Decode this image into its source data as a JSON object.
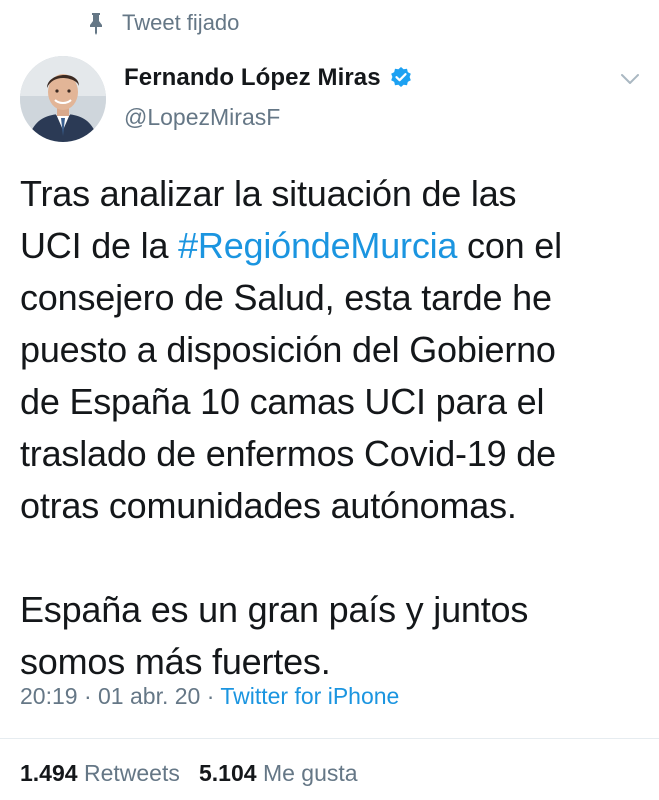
{
  "pinned_label": "Tweet fijado",
  "author": {
    "name": "Fernando López Miras",
    "handle": "@LopezMirasF",
    "verified": true
  },
  "tweet": {
    "line1": "Tras analizar la situación de las",
    "line2_pre": "UCI de la ",
    "hashtag": "#RegióndeMurcia",
    "line2_post": " con el",
    "line3": "consejero de Salud, esta tarde he",
    "line4": "puesto a disposición del Gobierno",
    "line5": "de España 10 camas UCI para el",
    "line6": "traslado de enfermos Covid-19 de",
    "line7": "otras comunidades autónomas.",
    "line8": "España es un gran país y juntos",
    "line9": "somos más fuertes."
  },
  "meta": {
    "time": "20:19",
    "date": "01 abr. 20",
    "source": "Twitter for iPhone",
    "separator": " · "
  },
  "stats": {
    "retweets_count": "1.494",
    "retweets_label": "Retweets",
    "likes_count": "5.104",
    "likes_label": "Me gusta"
  },
  "colors": {
    "link": "#1b95e0",
    "secondary": "#657786",
    "text": "#14171a",
    "verified": "#1da1f2"
  },
  "icons": [
    "pin-icon",
    "verified-badge-icon",
    "chevron-down-icon",
    "avatar"
  ]
}
